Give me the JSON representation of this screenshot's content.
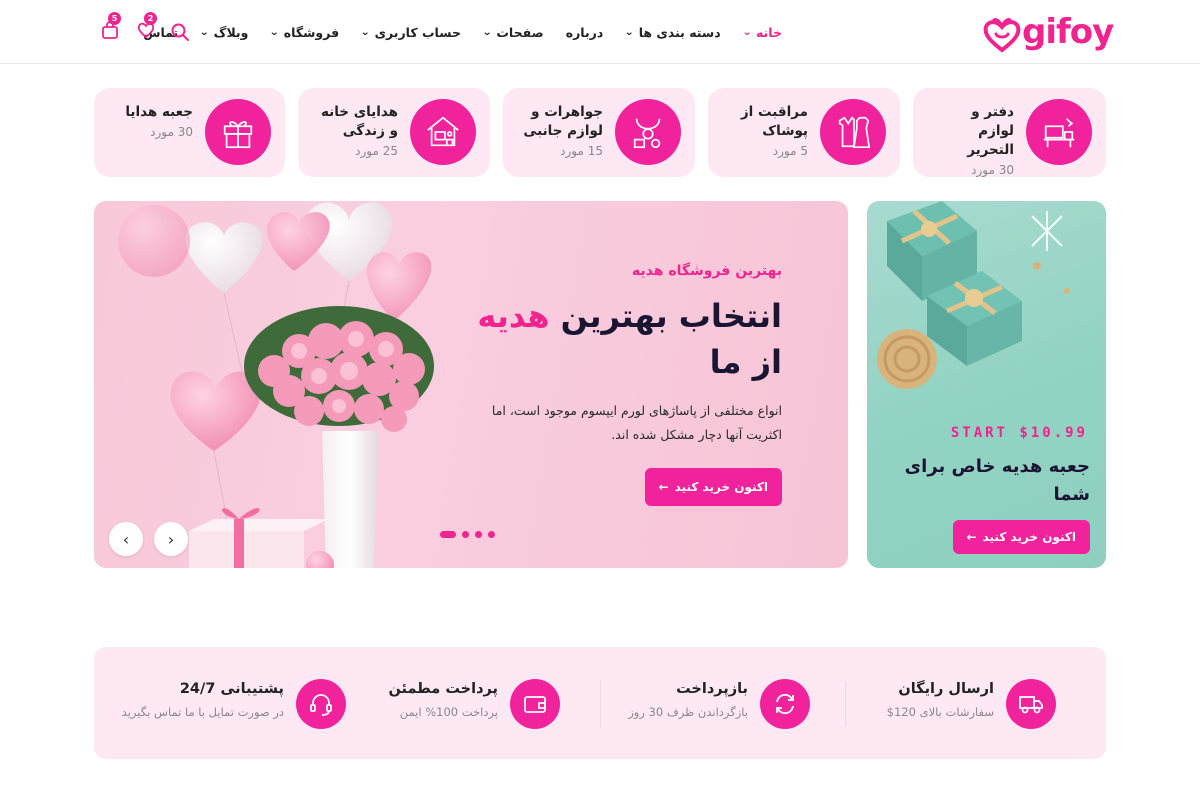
{
  "brand": {
    "name": "gifoy",
    "accent": "#f0238f",
    "card_bg": "#fde8f4"
  },
  "nav": [
    {
      "label": "خانه",
      "chevron": true,
      "active": true
    },
    {
      "label": "دسته بندی ها",
      "chevron": true
    },
    {
      "label": "درباره",
      "chevron": false
    },
    {
      "label": "صفحات",
      "chevron": true
    },
    {
      "label": "حساب کاربری",
      "chevron": true
    },
    {
      "label": "فروشگاه",
      "chevron": true
    },
    {
      "label": "وبلاگ",
      "chevron": true
    },
    {
      "label": "تماس",
      "chevron": false
    }
  ],
  "header_icons": {
    "wishlist_count": "2",
    "cart_count": "5",
    "search": "search-icon",
    "wishlist": "heart-icon",
    "cart": "bag-icon"
  },
  "categories": [
    {
      "title": "دفتر و لوازم التحریر",
      "count": "30 مورد",
      "icon": "desk-icon"
    },
    {
      "title": "مراقبت از پوشاک",
      "count": "5 مورد",
      "icon": "clothing-icon"
    },
    {
      "title": "جواهرات و لوازم جانبی",
      "count": "15 مورد",
      "icon": "jewelry-icon"
    },
    {
      "title": "هدایای خانه و زندگی",
      "count": "25 مورد",
      "icon": "home-icon"
    },
    {
      "title": "جعبه هدایا",
      "count": "30 مورد",
      "icon": "gift-icon"
    }
  ],
  "hero": {
    "subtitle": "بهترین فروشگاه هدیه",
    "title_before": "انتخاب بهترین ",
    "title_accent": "هدیه",
    "title_after": " از ما",
    "description": "انواع مختلفی از پاساژهای لورم ایپسوم موجود است، اما اکثریت آنها دچار مشکل شده اند.",
    "button": "اکنون خرید کنید",
    "slides": 4,
    "active_slide": 1
  },
  "promo": {
    "start": "START $10.99",
    "title": "جعبه هدیه خاص برای شما",
    "button": "اکنون خرید کنید"
  },
  "features": [
    {
      "title": "ارسال رایگان",
      "sub": "سفارشات بالای 120$",
      "icon": "truck-icon"
    },
    {
      "title": "بازپرداخت",
      "sub": "بازگرداندن ظرف 30 روز",
      "icon": "refresh-icon"
    },
    {
      "title": "پرداخت مطمئن",
      "sub": "پرداخت 100% ایمن",
      "icon": "wallet-icon"
    },
    {
      "title": "پشتیبانی 24/7",
      "sub": "در صورت تمایل با ما تماس بگیرید",
      "icon": "headset-icon"
    }
  ]
}
